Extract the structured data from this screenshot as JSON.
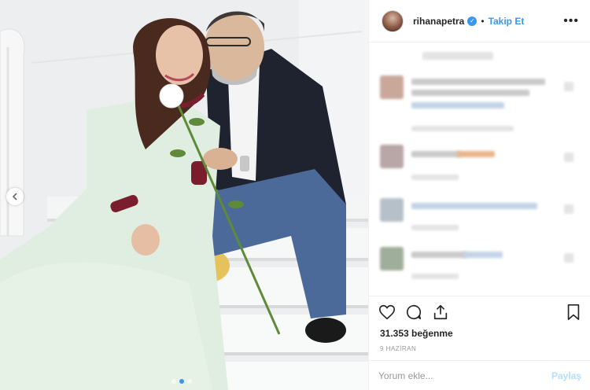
{
  "post": {
    "username": "rihanapetra",
    "separator": "•",
    "follow_label": "Takip Et",
    "more_icon": "more-horizontal-icon",
    "likes_text": "31.353 beğenme",
    "date_text": "9 HAZİRAN",
    "comment_placeholder": "Yorum ekle...",
    "post_label": "Paylaş"
  },
  "icons": {
    "like": "heart-icon",
    "comment": "comment-icon",
    "share": "share-icon",
    "save": "bookmark-icon",
    "prev": "chevron-left-icon",
    "verified": "verified-badge-icon"
  },
  "colors": {
    "link_blue": "#3897f0",
    "post_disabled": "#b2dffc",
    "muted": "#999999",
    "border": "#efefef"
  }
}
